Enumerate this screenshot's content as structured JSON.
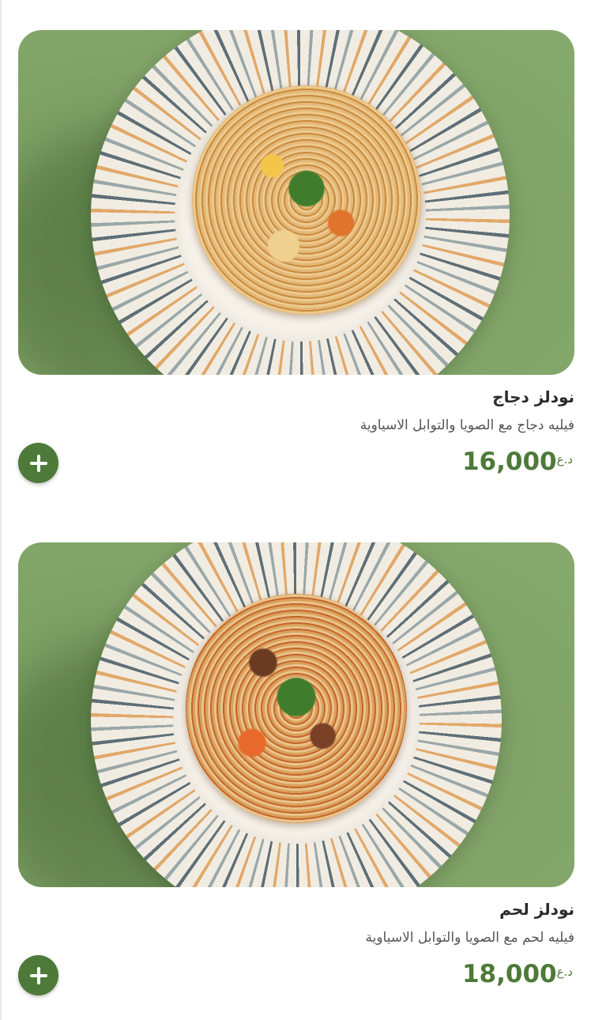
{
  "menu": {
    "items": [
      {
        "name": "نودلز دجاج",
        "description": "فيليه دجاج مع الصويا والتوابل الاسياوية",
        "price": "16,000",
        "currency": "د.ع"
      },
      {
        "name": "نودلز لحم",
        "description": "فيليه لحم مع الصويا والتوابل الاسياوية",
        "price": "18,000",
        "currency": "د.ع"
      }
    ]
  },
  "colors": {
    "accent": "#4d7a38",
    "background_green": "#7da064"
  },
  "icons": {
    "add": "plus-icon"
  }
}
